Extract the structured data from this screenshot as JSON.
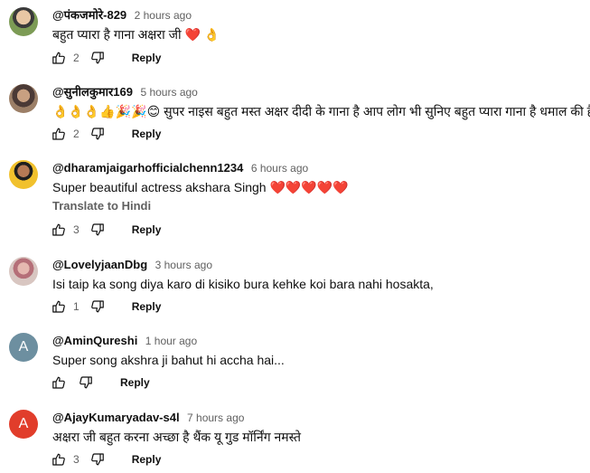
{
  "comments": [
    {
      "handle": "@पंकजमोरे-829",
      "time": "2 hours ago",
      "text": "बहुत प्यारा है गाना अक्षरा जी ❤️ 👌",
      "likes": "2",
      "reply": "Reply",
      "avatar": "profile-photo"
    },
    {
      "handle": "@सुनीलकुमार169",
      "time": "5 hours ago",
      "text": "👌👌👌👍🎉🎉😊 सुपर नाइस बहुत मस्त अक्षर दीदी के गाना है आप लोग भी सुनिए बहुत प्यारा गाना है धमाल की है",
      "likes": "2",
      "reply": "Reply",
      "avatar": "profile-photo"
    },
    {
      "handle": "@dharamjaigarhofficialchenn1234",
      "time": "6 hours ago",
      "text": "Super beautiful actress akshara Singh ❤️❤️❤️❤️❤️",
      "translate": "Translate to Hindi",
      "likes": "3",
      "reply": "Reply",
      "avatar": "profile-photo"
    },
    {
      "handle": "@LovelyjaanDbg",
      "time": "3 hours ago",
      "text": "Isi taip ka song diya karo di kisiko bura kehke koi bara nahi hosakta,",
      "likes": "1",
      "reply": "Reply",
      "avatar": "profile-photo"
    },
    {
      "handle": "@AminQureshi",
      "time": "1 hour ago",
      "text": "Super song akshra ji bahut hi accha hai...",
      "likes": "",
      "reply": "Reply",
      "avatar_letter": "A"
    },
    {
      "handle": "@AjayKumaryadav-s4l",
      "time": "7 hours ago",
      "text": "अक्षरा जी बहुत करना अच्छा है थैंक यू गुड मॉर्निंग नमस्ते",
      "likes": "3",
      "reply": "Reply",
      "avatar_letter": "A"
    }
  ],
  "icons": {
    "like": "thumbs-up-icon",
    "dislike": "thumbs-down-icon"
  },
  "colors": {
    "handle": "#0f0f0f",
    "secondary": "#606060",
    "avatar_a1": "#6d8fa0",
    "avatar_a2": "#e13d2b"
  }
}
